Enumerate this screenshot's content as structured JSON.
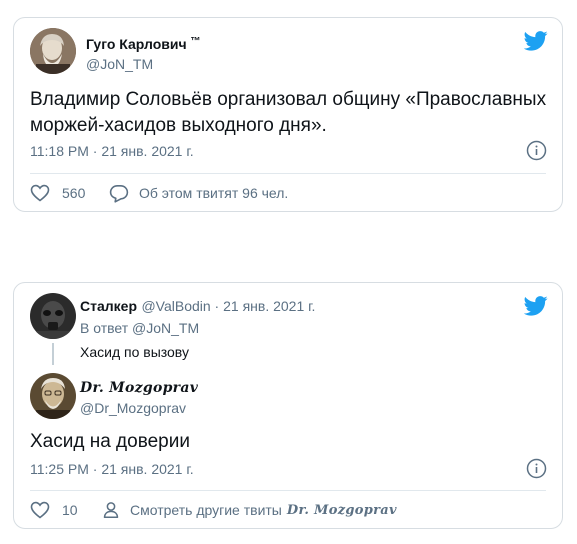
{
  "colors": {
    "twitter_blue": "#1da1f2",
    "secondary_text": "#5b7083",
    "border": "#d7dde2"
  },
  "tweet1": {
    "display_name": "Гуго Карлович",
    "badge": "™",
    "handle": "@JoN_TM",
    "text_line1": "Владимир Соловьёв организовал общину «Православных",
    "text_line2": "моржей-хасидов выходного дня».",
    "timestamp": "11:18 PM · 21 янв. 2021 г.",
    "likes": "560",
    "discussion": "Об этом твитят 96 чел.",
    "icons": [
      "twitter-bird-icon",
      "info-icon",
      "heart-icon",
      "comment-bubble-icon"
    ]
  },
  "tweet2": {
    "parent": {
      "display_name": "Сталкер",
      "handle_date": "@ValBodin · 21 янв. 2021 г.",
      "reply_to": "В ответ @JoN_TM",
      "text": "Хасид по вызову"
    },
    "display_name": "Dr. Mozgoprav",
    "handle": "@Dr_Mozgoprav",
    "text": "Хасид на доверии",
    "timestamp": "11:25 PM · 21 янв. 2021 г.",
    "likes": "10",
    "more_tweets_prefix": "Смотреть другие твиты",
    "more_tweets_name": "Dr. Mozgoprav",
    "icons": [
      "twitter-bird-icon",
      "info-icon",
      "heart-icon",
      "person-icon"
    ]
  }
}
